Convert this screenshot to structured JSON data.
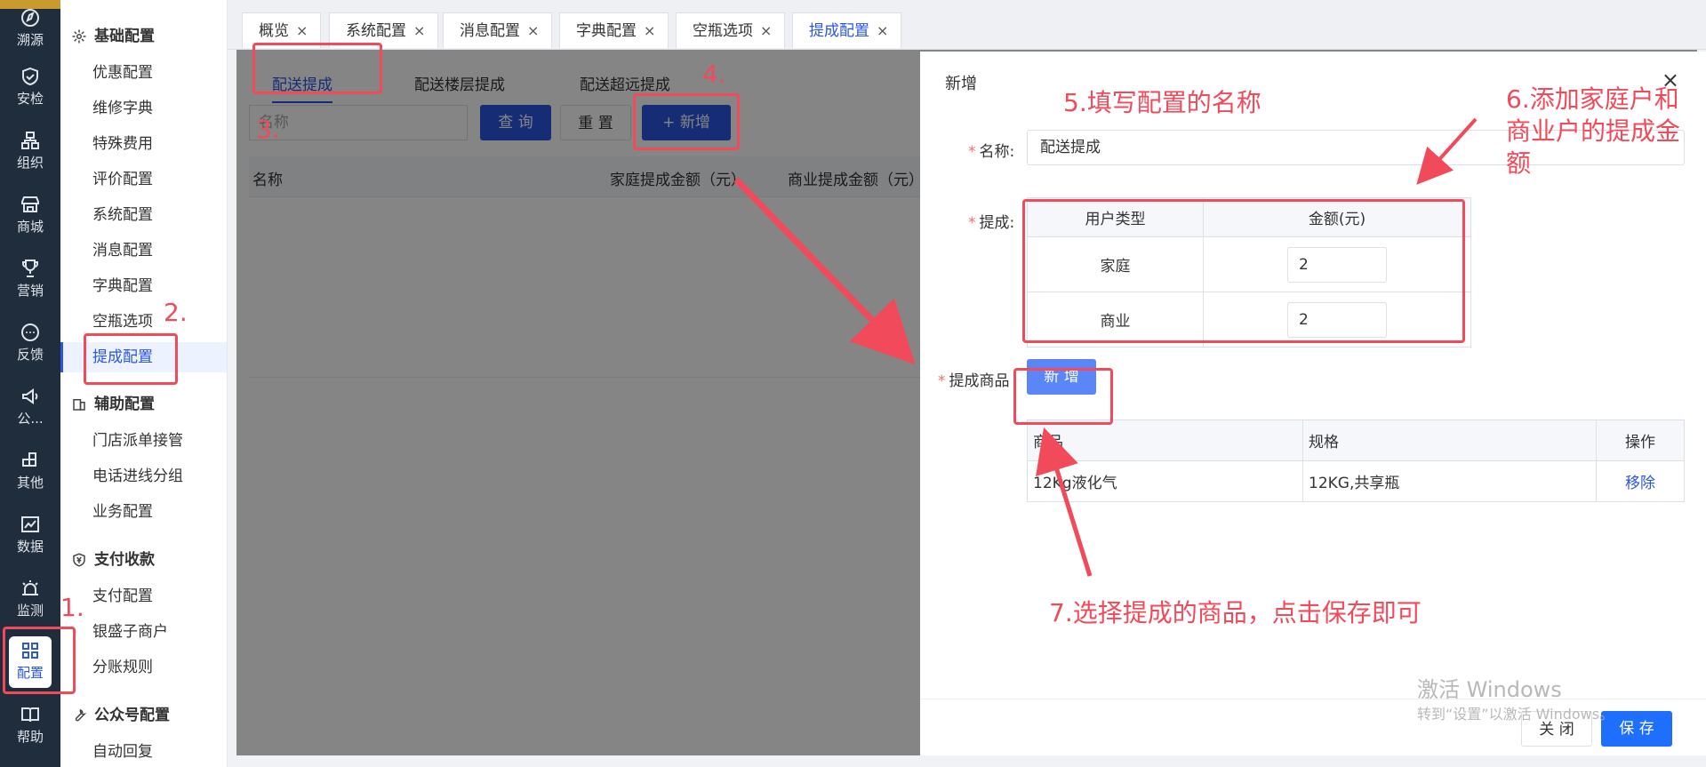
{
  "rail": {
    "items": [
      {
        "label": "溯源",
        "icon": "compass-icon"
      },
      {
        "label": "安检",
        "icon": "shield-icon"
      },
      {
        "label": "组织",
        "icon": "org-icon"
      },
      {
        "label": "商城",
        "icon": "store-icon"
      },
      {
        "label": "营销",
        "icon": "trophy-icon"
      },
      {
        "label": "反馈",
        "icon": "chat-icon"
      },
      {
        "label": "公...",
        "icon": "megaphone-icon"
      },
      {
        "label": "其他",
        "icon": "grid-plus-icon"
      },
      {
        "label": "数据",
        "icon": "chart-icon"
      },
      {
        "label": "监测",
        "icon": "alarm-icon"
      },
      {
        "label": "配置",
        "icon": "grid-icon"
      },
      {
        "label": "帮助",
        "icon": "book-icon"
      }
    ]
  },
  "menu": {
    "groups": [
      {
        "title": "基础配置",
        "icon": "gear-icon"
      },
      {
        "title": "辅助配置",
        "icon": "building-icon"
      },
      {
        "title": "支付收款",
        "icon": "yen-shield-icon"
      },
      {
        "title": "公众号配置",
        "icon": "wrench-icon"
      }
    ],
    "basic": [
      "优惠配置",
      "维修字典",
      "特殊费用",
      "评价配置",
      "系统配置",
      "消息配置",
      "字典配置",
      "空瓶选项",
      "提成配置"
    ],
    "aux": [
      "门店派单接管",
      "电话进线分组",
      "业务配置"
    ],
    "pay": [
      "支付配置",
      "银盛子商户",
      "分账规则"
    ],
    "wechat": [
      "自动回复"
    ]
  },
  "tabs": [
    "概览",
    "系统配置",
    "消息配置",
    "字典配置",
    "空瓶选项",
    "提成配置"
  ],
  "tab_close": "×",
  "subtabs": [
    "配送提成",
    "配送楼层提成",
    "配送超远提成"
  ],
  "search": {
    "placeholder": "名称"
  },
  "buttons": {
    "query": "查 询",
    "reset": "重 置",
    "add": "+ 新增"
  },
  "list_columns": [
    "名称",
    "家庭提成金额（元）",
    "商业提成金额（元）"
  ],
  "drawer": {
    "title": "新增",
    "close": "×",
    "name_label": "名称:",
    "name_value": "配送提成",
    "rate_label": "提成:",
    "rate_headers": [
      "用户类型",
      "金额(元)"
    ],
    "rates": [
      {
        "type": "家庭",
        "amount": "2"
      },
      {
        "type": "商业",
        "amount": "2"
      }
    ],
    "goods_label": "提成商品",
    "goods_add": "新 增",
    "goods_headers": [
      "商品",
      "规格",
      "操作"
    ],
    "goods": [
      {
        "name": "12Kg液化气",
        "spec": "12KG,共享瓶",
        "action": "移除"
      }
    ],
    "btn_close": "关 闭",
    "btn_save": "保 存"
  },
  "annotations": {
    "s1": "1.",
    "s2": "2.",
    "s3": "3.",
    "s4": "4.",
    "s5": "5.填写配置的名称",
    "s6": "6.添加家庭户和商业户的提成金额",
    "s7": "7.选择提成的商品，点击保存即可",
    "color": "#f04a5b"
  },
  "watermark": {
    "line1": "激活 Windows",
    "line2": "转到“设置”以激活 Windows。"
  }
}
